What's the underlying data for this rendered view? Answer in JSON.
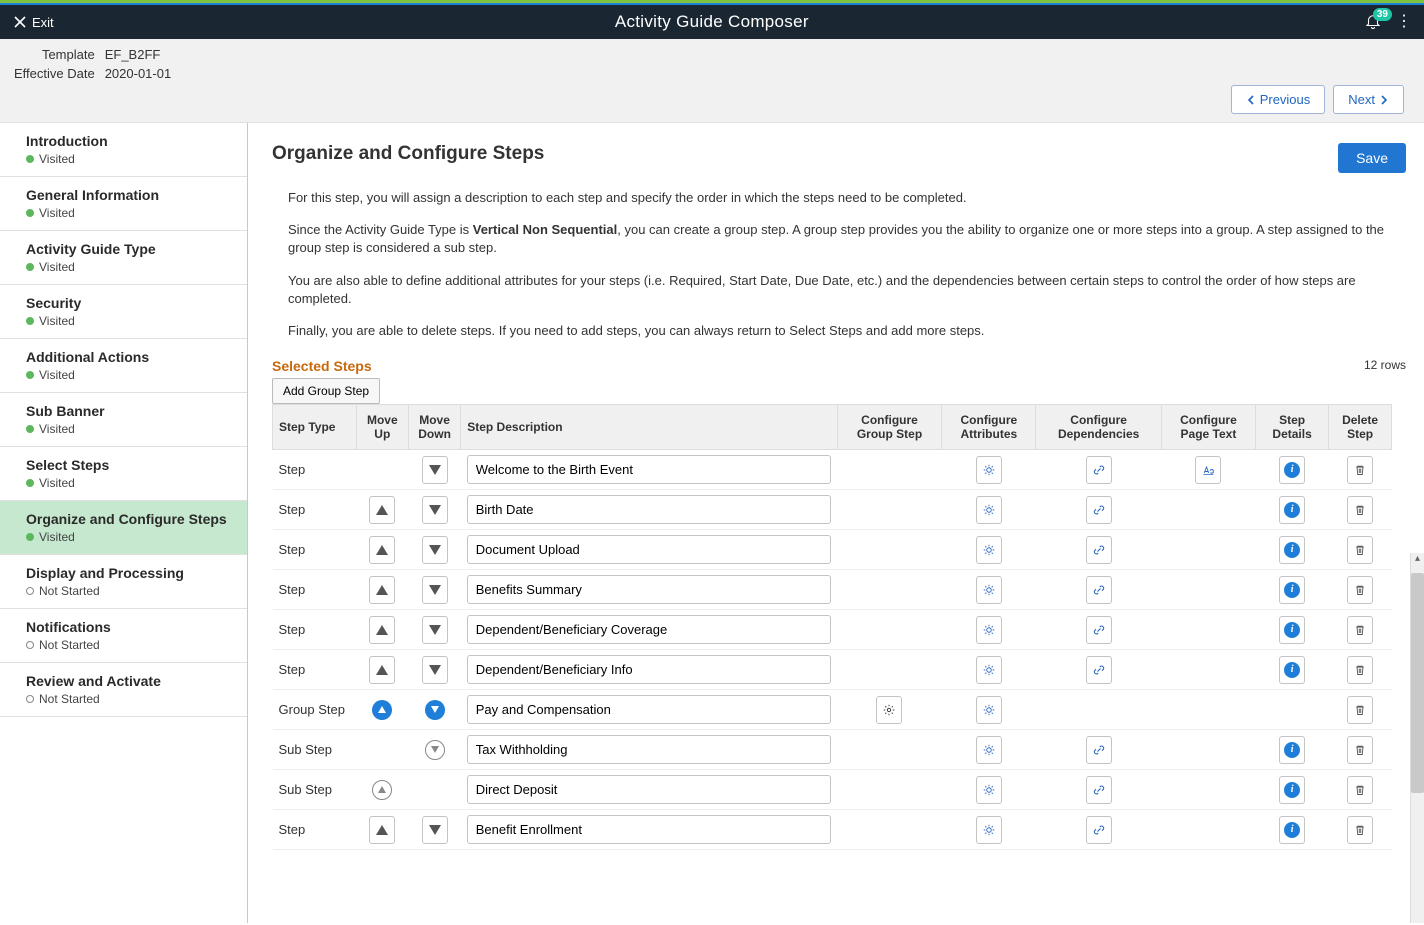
{
  "header": {
    "exit": "Exit",
    "title": "Activity Guide Composer",
    "badge": "39"
  },
  "meta": {
    "template_lbl": "Template",
    "template_val": "EF_B2FF",
    "eff_date_lbl": "Effective Date",
    "eff_date_val": "2020-01-01",
    "prev": "Previous",
    "next": "Next"
  },
  "sidebar": [
    {
      "title": "Introduction",
      "status": "Visited",
      "dot": "visited",
      "active": false
    },
    {
      "title": "General Information",
      "status": "Visited",
      "dot": "visited",
      "active": false
    },
    {
      "title": "Activity Guide Type",
      "status": "Visited",
      "dot": "visited",
      "active": false
    },
    {
      "title": "Security",
      "status": "Visited",
      "dot": "visited",
      "active": false
    },
    {
      "title": "Additional Actions",
      "status": "Visited",
      "dot": "visited",
      "active": false
    },
    {
      "title": "Sub Banner",
      "status": "Visited",
      "dot": "visited",
      "active": false
    },
    {
      "title": "Select Steps",
      "status": "Visited",
      "dot": "visited",
      "active": false
    },
    {
      "title": "Organize and Configure Steps",
      "status": "Visited",
      "dot": "visited",
      "active": true
    },
    {
      "title": "Display and Processing",
      "status": "Not Started",
      "dot": "notstarted",
      "active": false
    },
    {
      "title": "Notifications",
      "status": "Not Started",
      "dot": "notstarted",
      "active": false
    },
    {
      "title": "Review and Activate",
      "status": "Not Started",
      "dot": "notstarted",
      "active": false
    }
  ],
  "main": {
    "heading": "Organize and Configure Steps",
    "save": "Save",
    "p1": "For this step, you will assign a description to each step and specify the order in which the steps need to be completed.",
    "p2a": "Since the Activity Guide Type is ",
    "p2b": "Vertical Non Sequential",
    "p2c": ", you can create a group step. A group step provides you the ability to organize one or more steps into a group. A step assigned to the group step is considered a sub step.",
    "p3": "You are also able to define additional attributes for your steps (i.e. Required, Start Date, Due Date, etc.) and the dependencies between certain steps to control the order of how steps are completed.",
    "p4": "Finally, you are able to delete steps. If you need to add steps, you can always return to Select Steps and add more steps.",
    "section": "Selected Steps",
    "rows": "12 rows",
    "add_group": "Add Group Step"
  },
  "cols": {
    "type": "Step Type",
    "up": "Move Up",
    "down": "Move Down",
    "desc": "Step Description",
    "cgs": "Configure Group Step",
    "attr": "Configure Attributes",
    "dep": "Configure Dependencies",
    "pt": "Configure Page Text",
    "det": "Step Details",
    "del": "Delete Step"
  },
  "rows": [
    {
      "type": "Step",
      "desc": "Welcome to the Birth Event",
      "up": "",
      "down": "tri",
      "cgs": false,
      "attr": true,
      "dep": true,
      "pt": true,
      "det": true,
      "del": true
    },
    {
      "type": "Step",
      "desc": "Birth Date",
      "up": "tri",
      "down": "tri",
      "cgs": false,
      "attr": true,
      "dep": true,
      "pt": false,
      "det": true,
      "del": true
    },
    {
      "type": "Step",
      "desc": "Document Upload",
      "up": "tri",
      "down": "tri",
      "cgs": false,
      "attr": true,
      "dep": true,
      "pt": false,
      "det": true,
      "del": true
    },
    {
      "type": "Step",
      "desc": "Benefits Summary",
      "up": "tri",
      "down": "tri",
      "cgs": false,
      "attr": true,
      "dep": true,
      "pt": false,
      "det": true,
      "del": true
    },
    {
      "type": "Step",
      "desc": "Dependent/Beneficiary Coverage",
      "up": "tri",
      "down": "tri",
      "cgs": false,
      "attr": true,
      "dep": true,
      "pt": false,
      "det": true,
      "del": true
    },
    {
      "type": "Step",
      "desc": "Dependent/Beneficiary Info",
      "up": "tri",
      "down": "tri",
      "cgs": false,
      "attr": true,
      "dep": true,
      "pt": false,
      "det": true,
      "del": true
    },
    {
      "type": "Group Step",
      "desc": "Pay and Compensation",
      "up": "circle-blue-up",
      "down": "circle-blue-down",
      "cgs": true,
      "attr": true,
      "dep": false,
      "pt": false,
      "det": false,
      "del": true
    },
    {
      "type": "Sub Step",
      "desc": "Tax Withholding",
      "up": "",
      "down": "circle-outline-down",
      "cgs": false,
      "attr": true,
      "dep": true,
      "pt": false,
      "det": true,
      "del": true
    },
    {
      "type": "Sub Step",
      "desc": "Direct Deposit",
      "up": "circle-outline-up",
      "down": "",
      "cgs": false,
      "attr": true,
      "dep": true,
      "pt": false,
      "det": true,
      "del": true
    },
    {
      "type": "Step",
      "desc": "Benefit Enrollment",
      "up": "tri",
      "down": "tri",
      "cgs": false,
      "attr": true,
      "dep": true,
      "pt": false,
      "det": true,
      "del": true
    }
  ]
}
